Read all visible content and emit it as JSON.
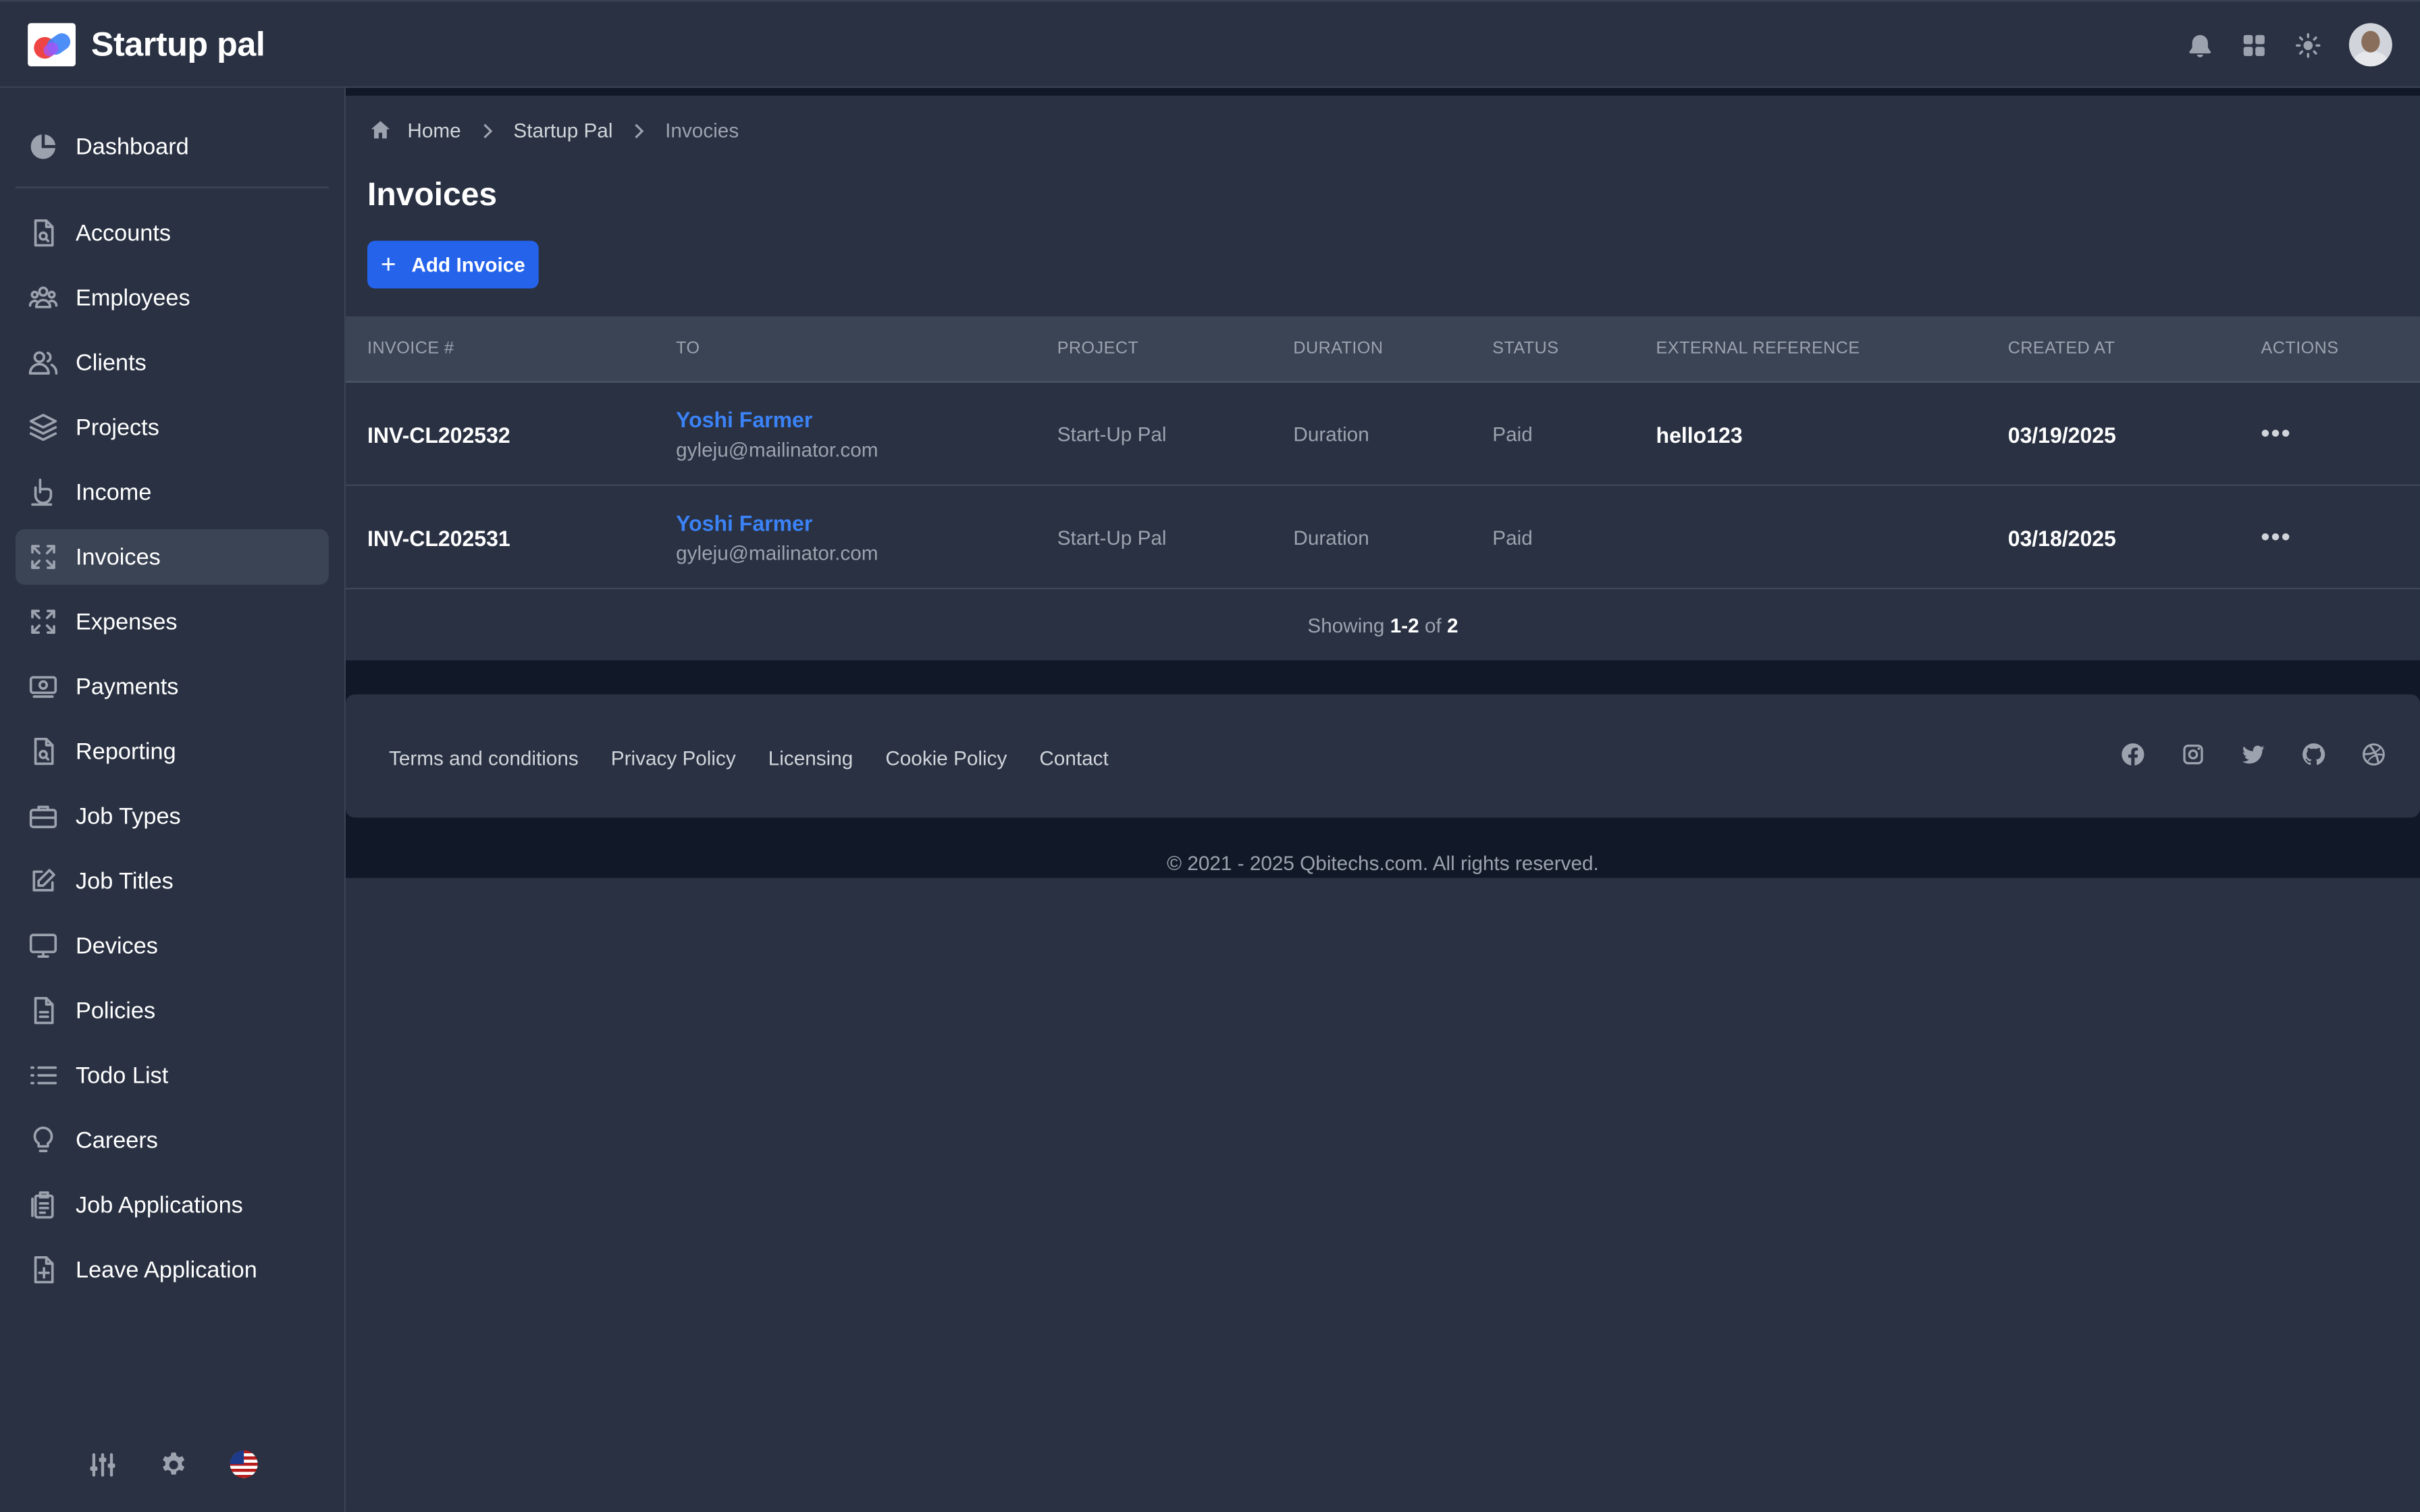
{
  "app": {
    "name": "Startup pal"
  },
  "topbar": {
    "icons": [
      "bell-icon",
      "apps-grid-icon",
      "sun-icon",
      "user-avatar"
    ]
  },
  "sidebar": {
    "items": [
      {
        "label": "Dashboard",
        "icon": "pie-chart-icon"
      },
      {
        "label": "Accounts",
        "icon": "document-search-icon"
      },
      {
        "label": "Employees",
        "icon": "users-icon"
      },
      {
        "label": "Clients",
        "icon": "user-group-icon"
      },
      {
        "label": "Projects",
        "icon": "layers-icon"
      },
      {
        "label": "Income",
        "icon": "hand-coin-icon"
      },
      {
        "label": "Invoices",
        "icon": "expand-arrows-icon",
        "active": true
      },
      {
        "label": "Expenses",
        "icon": "expand-arrows-icon"
      },
      {
        "label": "Payments",
        "icon": "cash-icon"
      },
      {
        "label": "Reporting",
        "icon": "document-search-icon"
      },
      {
        "label": "Job Types",
        "icon": "briefcase-icon"
      },
      {
        "label": "Job Titles",
        "icon": "pencil-square-icon"
      },
      {
        "label": "Devices",
        "icon": "desktop-icon"
      },
      {
        "label": "Policies",
        "icon": "document-text-icon"
      },
      {
        "label": "Todo List",
        "icon": "list-icon"
      },
      {
        "label": "Careers",
        "icon": "light-bulb-icon"
      },
      {
        "label": "Job Applications",
        "icon": "clipboard-copy-icon"
      },
      {
        "label": "Leave Application",
        "icon": "document-add-icon"
      }
    ],
    "bottom_icons": [
      "sliders-icon",
      "gear-icon",
      "us-flag-icon"
    ]
  },
  "breadcrumb": {
    "home": "Home",
    "parent": "Startup Pal",
    "current": "Invocies"
  },
  "page": {
    "title": "Invoices",
    "add_button": "Add Invoice"
  },
  "table": {
    "headers": {
      "invoice": "INVOICE #",
      "to": "TO",
      "project": "PROJECT",
      "duration": "DURATION",
      "status": "STATUS",
      "external_reference": "EXTERNAL REFERENCE",
      "created_at": "CREATED AT",
      "actions": "ACTIONS"
    },
    "rows": [
      {
        "invoice": "INV-CL202532",
        "to_name": "Yoshi Farmer",
        "to_email": "gyleju@mailinator.com",
        "project": "Start-Up Pal",
        "duration": "Duration",
        "status": "Paid",
        "external_reference": "hello123",
        "created_at": "03/19/2025",
        "actions": "•••"
      },
      {
        "invoice": "INV-CL202531",
        "to_name": "Yoshi Farmer",
        "to_email": "gyleju@mailinator.com",
        "project": "Start-Up Pal",
        "duration": "Duration",
        "status": "Paid",
        "external_reference": "",
        "created_at": "03/18/2025",
        "actions": "•••"
      }
    ],
    "pagination": {
      "prefix": "Showing",
      "range": "1-2",
      "of": "of",
      "total": "2"
    }
  },
  "footer": {
    "links": [
      "Terms and conditions",
      "Privacy Policy",
      "Licensing",
      "Cookie Policy",
      "Contact"
    ],
    "social_icons": [
      "facebook-icon",
      "instagram-icon",
      "twitter-icon",
      "github-icon",
      "dribbble-icon"
    ],
    "copyright": "© 2021 - 2025 Qbitechs.com. All rights reserved."
  },
  "colors": {
    "background": "#293142",
    "accent": "#2563eb",
    "link": "#3b82f6",
    "dark_band": "#111827"
  }
}
